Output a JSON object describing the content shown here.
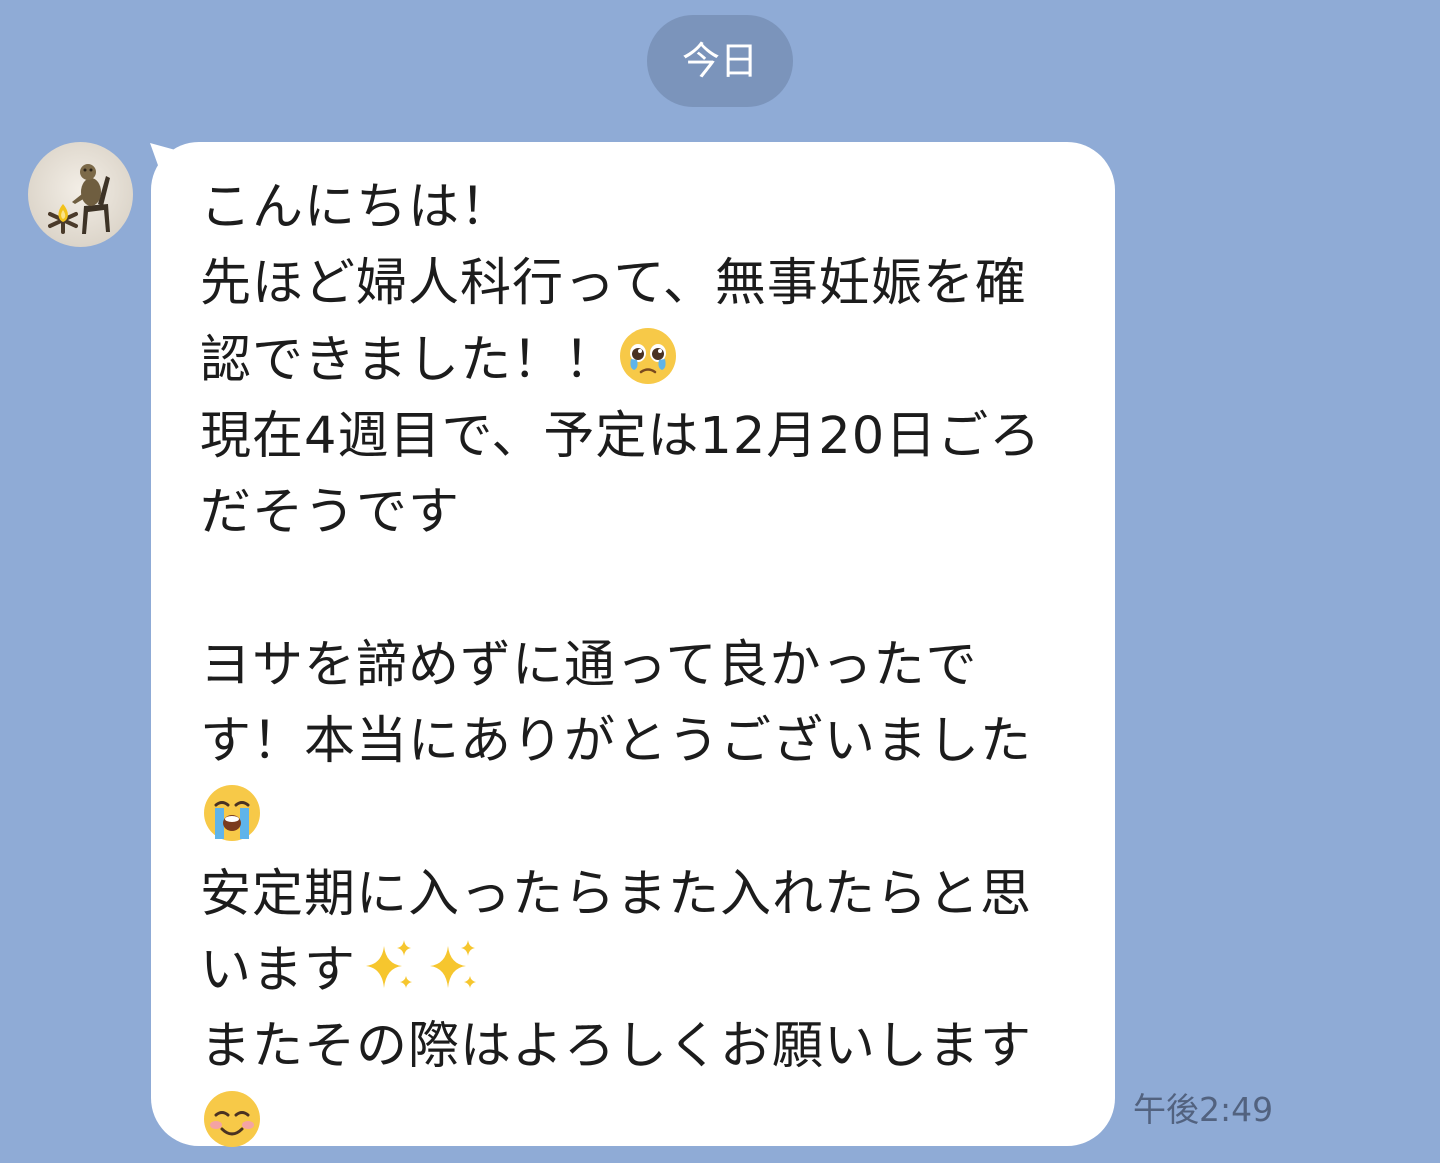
{
  "chat": {
    "date_label": "今日",
    "message": {
      "line_1": "こんにちは！",
      "line_2": "先ほど婦人科行って、無事妊娠を確",
      "line_3": "認できました！！",
      "line_4": "現在4週目で、予定は12月20日ごろ",
      "line_5": "だそうです",
      "line_6": "ヨサを諦めずに通って良かったで",
      "line_7": "す！本当にありがとうございました",
      "line_8": "安定期に入ったらまた入れたらと思",
      "line_9": "います",
      "line_10": "またその際はよろしくお願いします"
    },
    "timestamp": "午後2:49"
  },
  "icons": {
    "avatar": "avatar-photo-figure-by-campfire",
    "emoji_1": "pleading-face-emoji",
    "emoji_2": "loudly-crying-face-emoji",
    "emoji_3": "sparkles-emoji",
    "emoji_4": "smiling-face-emoji"
  },
  "colors": {
    "background": "#8fabd6",
    "date_pill": "#7b94bb",
    "bubble": "#ffffff",
    "message_text": "#1c1c1c",
    "timestamp_text": "#52627f"
  }
}
